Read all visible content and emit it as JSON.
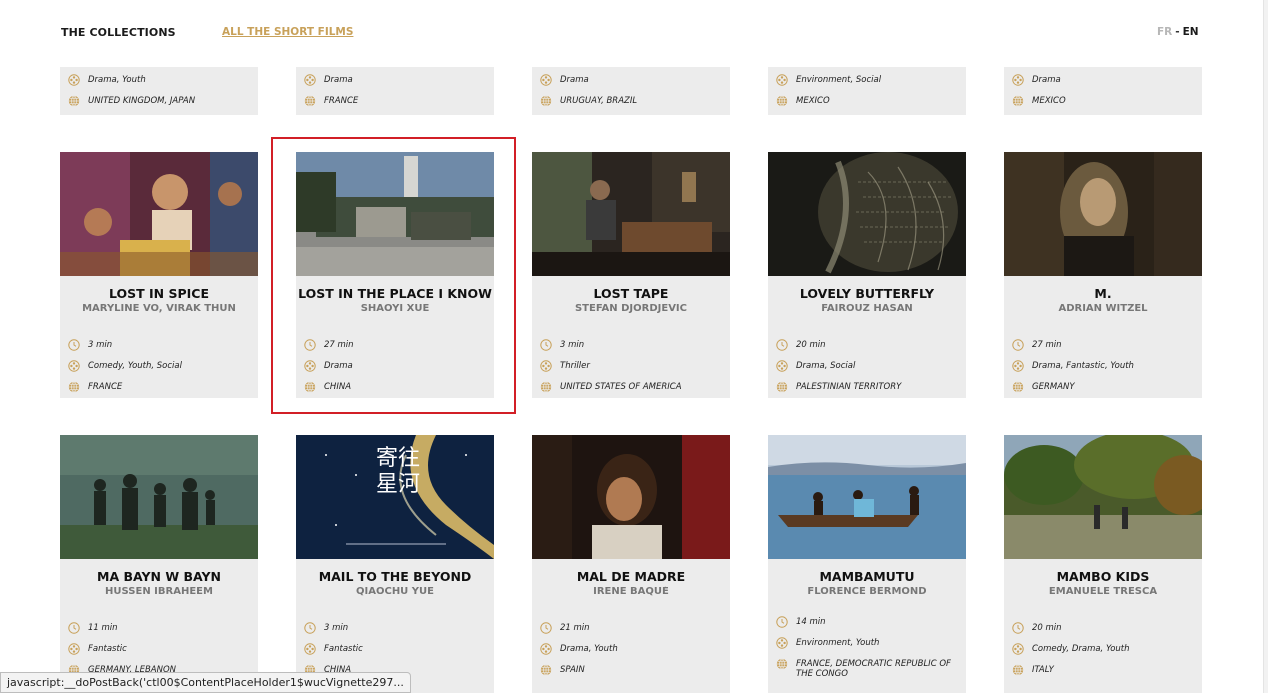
{
  "header": {
    "brand": "THE COLLECTIONS",
    "nav_all_films": "ALL THE SHORT FILMS",
    "lang_fr": "FR",
    "lang_sep": "-",
    "lang_en": "EN"
  },
  "colors": {
    "accent_gold": "#c8a15a",
    "card_bg": "#ececec",
    "highlight_red": "#d21f26"
  },
  "icons": {
    "duration": "clock-icon",
    "genre": "film-reel-icon",
    "country": "globe-icon"
  },
  "partial_row": [
    {
      "genre": "Drama, Youth",
      "country": "UNITED KINGDOM, JAPAN"
    },
    {
      "genre": "Drama",
      "country": "FRANCE"
    },
    {
      "genre": "Drama",
      "country": "URUGUAY, BRAZIL"
    },
    {
      "genre": "Environment, Social",
      "country": "MEXICO"
    },
    {
      "genre": "Drama",
      "country": "MEXICO"
    }
  ],
  "row1": [
    {
      "title": "LOST IN SPICE",
      "director": "MARYLINE VO, VIRAK THUN",
      "duration": "3 min",
      "genre": "Comedy, Youth, Social",
      "country": "FRANCE"
    },
    {
      "title": "LOST IN THE PLACE I KNOW",
      "director": "SHAOYI XUE",
      "duration": "27 min",
      "genre": "Drama",
      "country": "CHINA"
    },
    {
      "title": "LOST TAPE",
      "director": "STEFAN DJORDJEVIC",
      "duration": "3 min",
      "genre": "Thriller",
      "country": "UNITED STATES OF AMERICA"
    },
    {
      "title": "LOVELY BUTTERFLY",
      "director": "FAIROUZ HASAN",
      "duration": "20 min",
      "genre": "Drama, Social",
      "country": "PALESTINIAN TERRITORY"
    },
    {
      "title": "M.",
      "director": "ADRIAN WITZEL",
      "duration": "27 min",
      "genre": "Drama, Fantastic, Youth",
      "country": "GERMANY"
    }
  ],
  "row2": [
    {
      "title": "MA BAYN W BAYN",
      "director": "HUSSEN IBRAHEEM",
      "duration": "11 min",
      "genre": "Fantastic",
      "country": "GERMANY, LEBANON"
    },
    {
      "title": "MAIL TO THE BEYOND",
      "director": "QIAOCHU YUE",
      "duration": "3 min",
      "genre": "Fantastic",
      "country": "CHINA",
      "poster_text": "寄往\n星河"
    },
    {
      "title": "MAL DE MADRE",
      "director": "IRENE BAQUÉ",
      "duration": "21 min",
      "genre": "Drama, Youth",
      "country": "SPAIN"
    },
    {
      "title": "MAMBAMUTU",
      "director": "FLORENCE BERMOND",
      "duration": "14 min",
      "genre": "Environment, Youth",
      "country": "FRANCE, DEMOCRATIC REPUBLIC OF THE CONGO"
    },
    {
      "title": "MAMBO KIDS",
      "director": "EMANUELE TRESCA",
      "duration": "20 min",
      "genre": "Comedy, Drama, Youth",
      "country": "ITALY"
    }
  ],
  "status_bar": "javascript:__doPostBack('ctl00$ContentPlaceHolder1$wucVignette297..."
}
